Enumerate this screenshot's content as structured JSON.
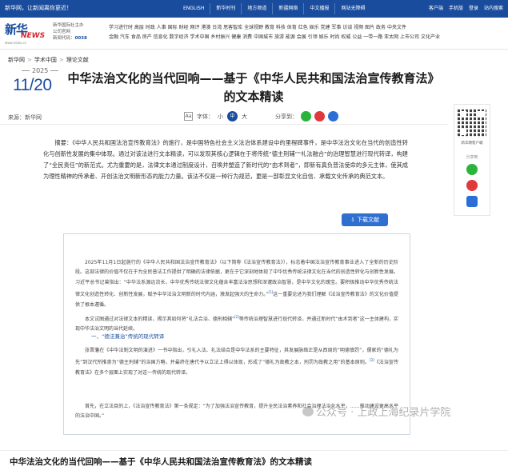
{
  "topbar": {
    "welcome": "新华网，让新闻离你更近！",
    "nav": [
      "ENGLISH",
      "新华时刊",
      "地方频道",
      "新疆网络",
      "中文播报",
      "网站无障碍"
    ],
    "util": [
      "客户端",
      "手机版",
      "登录",
      "站内搜索"
    ]
  },
  "header": {
    "logo_main": "新华",
    "logo_news": "NEWS",
    "logo_url": "www.news.cn",
    "info_line1": "新华国际社主办",
    "info_line2": "公司官网",
    "info_code_label": "新闻代码：",
    "info_code": "0038",
    "channels_row1": "学习进行时 高层 时政 人事 国际 财经 网评 港澳 台湾 思客智库 全球视野 教育 科技 体育 红色 娱乐 党建 军事 访谈 视频 图片 政务 中央文件",
    "channels_row2": "金融 汽车 食品 房产 信息化 数字经济 学术中国 乡村振兴 健康 消费 中国城市 旅游 能源 会展 引领 娱乐 时尚 权威 公益 一带一路 亚太网 上市公司 文化产业"
  },
  "breadcrumb": [
    "新华网",
    "学术中国",
    "理论文献"
  ],
  "date": {
    "year": "2025",
    "month_day": "11/20"
  },
  "headline": "中华法治文化的当代回响——基于《中华人民共和国法治宣传教育法》的文本精读",
  "meta": {
    "source": "来源：新华网",
    "font_label": "字体：",
    "font_aa": "Aa",
    "size_small": "小",
    "size_mid": "中",
    "size_large": "大",
    "share_label": "分享到："
  },
  "rail": {
    "qr_caption": "新华网客户端",
    "share_caption": "分享到"
  },
  "abstract": "摘要：《中华人民共和国法治宣传教育法》的施行，是中国特色社会主义法治体系建设中的里程碑事件，是中华法治文化在当代的创造性转化与创新性发展的集中体现。通过对该法进行文本精读，可以发现其核心逻辑在于将传统“德主刑辅”“礼法融合”的治理智慧进行现代转译，构建了“全民责任”的新范式。尤为重要的是，法律文本通过制度设计，召唤并塑造了新时代的“由术到者”，即新有真负普法使命的多元主体，使其成为理性精神的传承者、开创法治文明新形态的能力力量。该法不仅是一种行为规范，更是一部彰显文化自信、承载文化传承的典范文本。",
  "download_label": "下载文献",
  "doc": {
    "p1": "2025年11月1日起施行的《中华人民共和国法治宣传教育法》（以下简称《法治宣传教育法》），标志着中国法治宣传教育事业进入了全新的历史阶段。这部法律的价值不仅在于为全民普法工作提供了明确的法律依据，更在于它深刻地体现了中华优秀传统法律文化在当代的创造性转化与创新性发展。习近平总书记曾指出：“中华法系源远流长，中华优秀传统法律文化蕴含丰富法治思想和深邃政治智慧，是中华文化的瑰宝。要积极推动中华优秀传统法律文化创造性转化、创新性发展，赋予中华法治文明新的时代内涵，激发起强大的生命力。”",
    "p1_ref": "[1]",
    "p1_tail": "这一重要论述为我们理解《法治宣传教育法》的文化价值提供了根本遵循。",
    "p2": "本文试图通过对法律文本的精读，揭示其如何将“礼法合治、德刑相辅”",
    "p2_ref": "[2]",
    "p2_tail": "等传统治理智慧进行现代转译，并通过新时代“由术到者”这一主体建构，实现中华法治文明的当代延续。",
    "h1": "一、“德法兼治”传统的现代转译",
    "p3": "张晋藩在《中华法制文明的演进》一书中指出，引礼入法、礼法结合是中华法系的主要特征，其发展脉络正是从西周的“明德慎罚”，儒家的“德礼为先”到汉代所推崇为“德主刑辅”的治国方略，并最终在唐代予以立法上得以体现，形成了“德礼为政教之本，刑罚为政教之用”的基本原则。",
    "p3_ref": "[3]",
    "p3_tail": "《法治宣传教育法》在多个层面上实现了对这一传统的现代转译。",
    "p4": "首先，在立法目的上，《法治宣传教育法》第一条规定：“为了加强法治宣传教育，提升全民法治素养和社会治理法治化水平，……推动建设更高水平的法治中国。”"
  },
  "watermark": "公众号 · 上政上海纪录片学院",
  "bottom_title": "中华法治文化的当代回响——基于《中华人民共和国法治宣传教育法》的文本精读"
}
